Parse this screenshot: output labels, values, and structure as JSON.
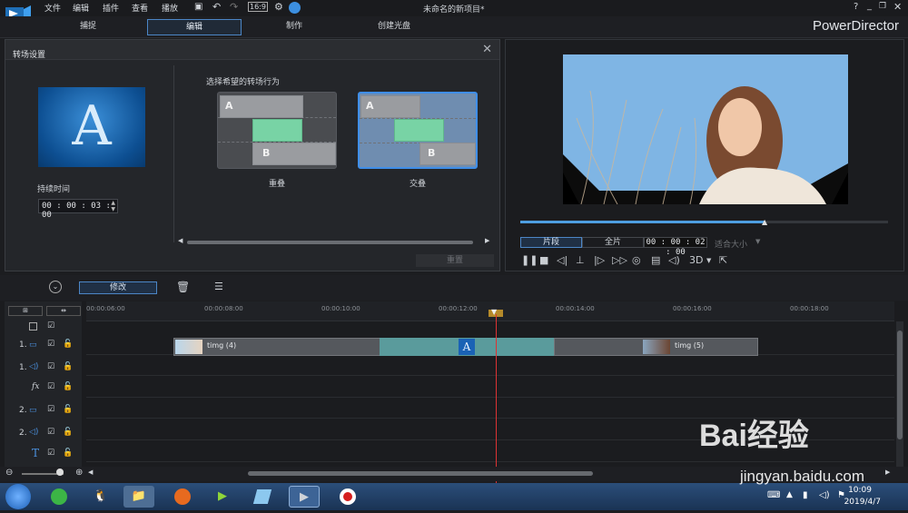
{
  "menu": {
    "file": "文件",
    "edit": "编辑",
    "plugins": "插件",
    "view": "查看",
    "play": "播放"
  },
  "window": {
    "title": "未命名的新项目*",
    "brand": "PowerDirector",
    "help": "?"
  },
  "modes": [
    {
      "label": "捕捉"
    },
    {
      "label": "编辑"
    },
    {
      "label": "制作"
    },
    {
      "label": "创建光盘"
    }
  ],
  "transition_panel": {
    "title": "转场设置",
    "duration_label": "持续时间",
    "duration": "00 : 00 : 03 : 00",
    "behavior_label": "选择希望的转场行为",
    "preview_letter": "A",
    "options": [
      {
        "label": "重叠",
        "a": "A",
        "b": "B"
      },
      {
        "label": "交叠",
        "a": "A",
        "b": "B"
      }
    ],
    "reset_label": "重置"
  },
  "preview": {
    "segment_label": "片段",
    "full_label": "全片",
    "timecode": "00 : 00 : 02 : 00",
    "fit_label": "适合大小",
    "mode_3d": "3D",
    "progress": 0.667
  },
  "toolbar": {
    "modify_label": "修改"
  },
  "timeline": {
    "ticks": [
      "00:00:06:00",
      "00:00:08:00",
      "00:00:10:00",
      "00:00:12:00",
      "00:00:14:00",
      "00:00:16:00",
      "00:00:18:00"
    ],
    "tracks": [
      "1.",
      "1.",
      "fx",
      "2.",
      "2.",
      "T"
    ],
    "clip1_name": "timg (4)",
    "clip2_name": "timg (5)",
    "transition_letter": "A"
  },
  "taskbar": {
    "time": "10:09",
    "date": "2019/4/7"
  },
  "watermark": {
    "brand": "Bai经验",
    "url": "jingyan.baidu.com"
  }
}
